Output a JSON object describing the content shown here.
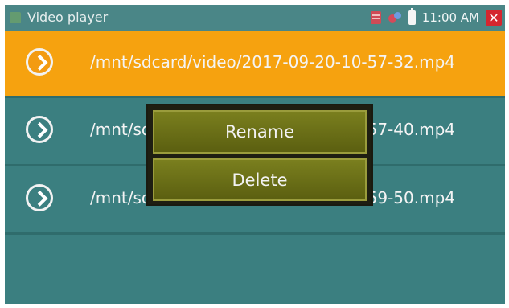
{
  "statusbar": {
    "title": "Video player",
    "time": "11:00 AM",
    "icons": [
      "sd-card-icon",
      "usb-icon",
      "battery-icon",
      "close-icon"
    ],
    "close_label": "✕"
  },
  "files": [
    {
      "path": "/mnt/sdcard/video/2017-09-20-10-57-32.mp4",
      "selected": true
    },
    {
      "path": "/mnt/sdcard/video/2017-09-20-10-57-40.mp4",
      "selected": false
    },
    {
      "path": "/mnt/sdcard/video/2017-09-20-10-59-50.mp4",
      "selected": false
    }
  ],
  "context_menu": {
    "items": [
      "Rename",
      "Delete"
    ]
  },
  "colors": {
    "background": "#3b7f80",
    "selected_row": "#f6a20f",
    "menu_button": "#6b6f18",
    "close_button": "#d4262f"
  }
}
